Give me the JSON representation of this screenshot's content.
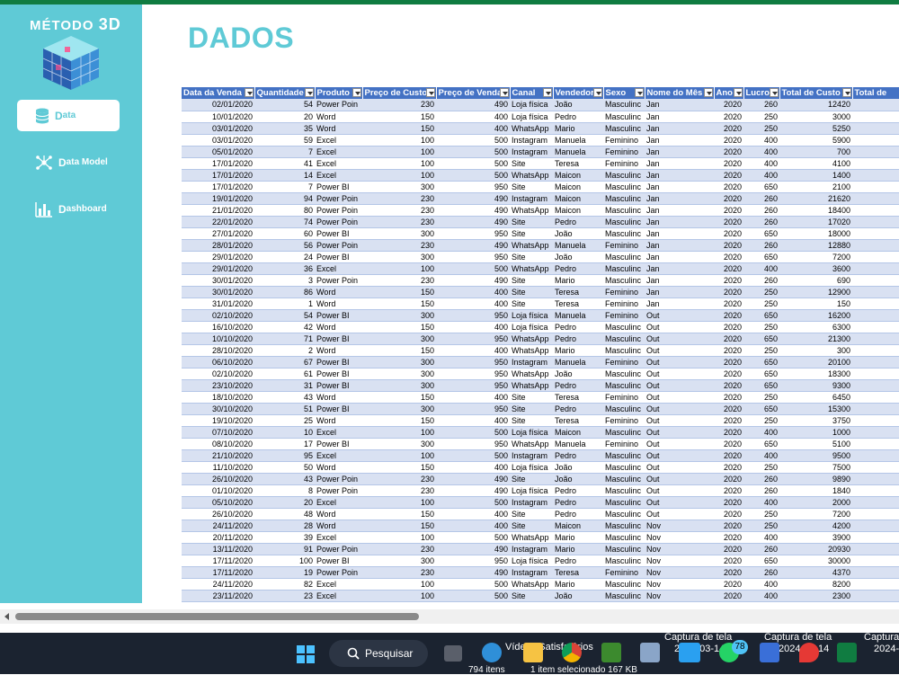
{
  "app": {
    "logo_text_a": "MÉTODO",
    "logo_text_b": "3D",
    "page_title": "DADOS",
    "accent_color": "#5fcad6"
  },
  "sidebar": {
    "items": [
      {
        "first": "D",
        "rest": "ata",
        "icon": "database-icon",
        "active": true
      },
      {
        "first": "D",
        "rest": "ata Model",
        "icon": "network-icon",
        "active": false
      },
      {
        "first": "D",
        "rest": "ashboard",
        "icon": "bar-chart-icon",
        "active": false
      }
    ]
  },
  "table": {
    "headers": [
      "Data da Venda",
      "Quantidade",
      "Produto",
      "Preço de Custo",
      "Preço de Venda",
      "Canal",
      "Vendedor",
      "Sexo",
      "Nome do Mês",
      "Ano",
      "Lucro",
      "Total de Custo",
      "Total de"
    ],
    "rows": [
      [
        "02/01/2020",
        "54",
        "Power Poin",
        "230",
        "490",
        "Loja física",
        "João",
        "Masculinc",
        "Jan",
        "2020",
        "260",
        "12420"
      ],
      [
        "10/01/2020",
        "20",
        "Word",
        "150",
        "400",
        "Loja física",
        "Pedro",
        "Masculinc",
        "Jan",
        "2020",
        "250",
        "3000"
      ],
      [
        "03/01/2020",
        "35",
        "Word",
        "150",
        "400",
        "WhatsApp",
        "Mario",
        "Masculinc",
        "Jan",
        "2020",
        "250",
        "5250"
      ],
      [
        "03/01/2020",
        "59",
        "Excel",
        "100",
        "500",
        "Instagram",
        "Manuela",
        "Feminino",
        "Jan",
        "2020",
        "400",
        "5900"
      ],
      [
        "05/01/2020",
        "7",
        "Excel",
        "100",
        "500",
        "Instagram",
        "Manuela",
        "Feminino",
        "Jan",
        "2020",
        "400",
        "700"
      ],
      [
        "17/01/2020",
        "41",
        "Excel",
        "100",
        "500",
        "Site",
        "Teresa",
        "Feminino",
        "Jan",
        "2020",
        "400",
        "4100"
      ],
      [
        "17/01/2020",
        "14",
        "Excel",
        "100",
        "500",
        "WhatsApp",
        "Maicon",
        "Masculinc",
        "Jan",
        "2020",
        "400",
        "1400"
      ],
      [
        "17/01/2020",
        "7",
        "Power BI",
        "300",
        "950",
        "Site",
        "Maicon",
        "Masculinc",
        "Jan",
        "2020",
        "650",
        "2100"
      ],
      [
        "19/01/2020",
        "94",
        "Power Poin",
        "230",
        "490",
        "Instagram",
        "Maicon",
        "Masculinc",
        "Jan",
        "2020",
        "260",
        "21620"
      ],
      [
        "21/01/2020",
        "80",
        "Power Poin",
        "230",
        "490",
        "WhatsApp",
        "Maicon",
        "Masculinc",
        "Jan",
        "2020",
        "260",
        "18400"
      ],
      [
        "22/01/2020",
        "74",
        "Power Poin",
        "230",
        "490",
        "Site",
        "Pedro",
        "Masculinc",
        "Jan",
        "2020",
        "260",
        "17020"
      ],
      [
        "27/01/2020",
        "60",
        "Power BI",
        "300",
        "950",
        "Site",
        "João",
        "Masculinc",
        "Jan",
        "2020",
        "650",
        "18000"
      ],
      [
        "28/01/2020",
        "56",
        "Power Poin",
        "230",
        "490",
        "WhatsApp",
        "Manuela",
        "Feminino",
        "Jan",
        "2020",
        "260",
        "12880"
      ],
      [
        "29/01/2020",
        "24",
        "Power BI",
        "300",
        "950",
        "Site",
        "João",
        "Masculinc",
        "Jan",
        "2020",
        "650",
        "7200"
      ],
      [
        "29/01/2020",
        "36",
        "Excel",
        "100",
        "500",
        "WhatsApp",
        "Pedro",
        "Masculinc",
        "Jan",
        "2020",
        "400",
        "3600"
      ],
      [
        "30/01/2020",
        "3",
        "Power Poin",
        "230",
        "490",
        "Site",
        "Mario",
        "Masculinc",
        "Jan",
        "2020",
        "260",
        "690"
      ],
      [
        "30/01/2020",
        "86",
        "Word",
        "150",
        "400",
        "Site",
        "Teresa",
        "Feminino",
        "Jan",
        "2020",
        "250",
        "12900"
      ],
      [
        "31/01/2020",
        "1",
        "Word",
        "150",
        "400",
        "Site",
        "Teresa",
        "Feminino",
        "Jan",
        "2020",
        "250",
        "150"
      ],
      [
        "02/10/2020",
        "54",
        "Power BI",
        "300",
        "950",
        "Loja física",
        "Manuela",
        "Feminino",
        "Out",
        "2020",
        "650",
        "16200"
      ],
      [
        "16/10/2020",
        "42",
        "Word",
        "150",
        "400",
        "Loja física",
        "Pedro",
        "Masculinc",
        "Out",
        "2020",
        "250",
        "6300"
      ],
      [
        "10/10/2020",
        "71",
        "Power BI",
        "300",
        "950",
        "WhatsApp",
        "Pedro",
        "Masculinc",
        "Out",
        "2020",
        "650",
        "21300"
      ],
      [
        "28/10/2020",
        "2",
        "Word",
        "150",
        "400",
        "WhatsApp",
        "Mario",
        "Masculinc",
        "Out",
        "2020",
        "250",
        "300"
      ],
      [
        "06/10/2020",
        "67",
        "Power BI",
        "300",
        "950",
        "Instagram",
        "Manuela",
        "Feminino",
        "Out",
        "2020",
        "650",
        "20100"
      ],
      [
        "02/10/2020",
        "61",
        "Power BI",
        "300",
        "950",
        "WhatsApp",
        "João",
        "Masculinc",
        "Out",
        "2020",
        "650",
        "18300"
      ],
      [
        "23/10/2020",
        "31",
        "Power BI",
        "300",
        "950",
        "WhatsApp",
        "Pedro",
        "Masculinc",
        "Out",
        "2020",
        "650",
        "9300"
      ],
      [
        "18/10/2020",
        "43",
        "Word",
        "150",
        "400",
        "Site",
        "Teresa",
        "Feminino",
        "Out",
        "2020",
        "250",
        "6450"
      ],
      [
        "30/10/2020",
        "51",
        "Power BI",
        "300",
        "950",
        "Site",
        "Pedro",
        "Masculinc",
        "Out",
        "2020",
        "650",
        "15300"
      ],
      [
        "19/10/2020",
        "25",
        "Word",
        "150",
        "400",
        "Site",
        "Teresa",
        "Feminino",
        "Out",
        "2020",
        "250",
        "3750"
      ],
      [
        "07/10/2020",
        "10",
        "Excel",
        "100",
        "500",
        "Loja física",
        "Maicon",
        "Masculinc",
        "Out",
        "2020",
        "400",
        "1000"
      ],
      [
        "08/10/2020",
        "17",
        "Power BI",
        "300",
        "950",
        "WhatsApp",
        "Manuela",
        "Feminino",
        "Out",
        "2020",
        "650",
        "5100"
      ],
      [
        "21/10/2020",
        "95",
        "Excel",
        "100",
        "500",
        "Instagram",
        "Pedro",
        "Masculinc",
        "Out",
        "2020",
        "400",
        "9500"
      ],
      [
        "11/10/2020",
        "50",
        "Word",
        "150",
        "400",
        "Loja física",
        "João",
        "Masculinc",
        "Out",
        "2020",
        "250",
        "7500"
      ],
      [
        "26/10/2020",
        "43",
        "Power Poin",
        "230",
        "490",
        "Site",
        "João",
        "Masculinc",
        "Out",
        "2020",
        "260",
        "9890"
      ],
      [
        "01/10/2020",
        "8",
        "Power Poin",
        "230",
        "490",
        "Loja física",
        "Pedro",
        "Masculinc",
        "Out",
        "2020",
        "260",
        "1840"
      ],
      [
        "05/10/2020",
        "20",
        "Excel",
        "100",
        "500",
        "Instagram",
        "Pedro",
        "Masculinc",
        "Out",
        "2020",
        "400",
        "2000"
      ],
      [
        "26/10/2020",
        "48",
        "Word",
        "150",
        "400",
        "Site",
        "Pedro",
        "Masculinc",
        "Out",
        "2020",
        "250",
        "7200"
      ],
      [
        "24/11/2020",
        "28",
        "Word",
        "150",
        "400",
        "Site",
        "Maicon",
        "Masculinc",
        "Nov",
        "2020",
        "250",
        "4200"
      ],
      [
        "20/11/2020",
        "39",
        "Excel",
        "100",
        "500",
        "WhatsApp",
        "Mario",
        "Masculinc",
        "Nov",
        "2020",
        "400",
        "3900"
      ],
      [
        "13/11/2020",
        "91",
        "Power Poin",
        "230",
        "490",
        "Instagram",
        "Mario",
        "Masculinc",
        "Nov",
        "2020",
        "260",
        "20930"
      ],
      [
        "17/11/2020",
        "100",
        "Power BI",
        "300",
        "950",
        "Loja física",
        "Pedro",
        "Masculinc",
        "Nov",
        "2020",
        "650",
        "30000"
      ],
      [
        "17/11/2020",
        "19",
        "Power Poin",
        "230",
        "490",
        "Instagram",
        "Teresa",
        "Feminino",
        "Nov",
        "2020",
        "260",
        "4370"
      ],
      [
        "24/11/2020",
        "82",
        "Excel",
        "100",
        "500",
        "WhatsApp",
        "Mario",
        "Masculinc",
        "Nov",
        "2020",
        "400",
        "8200"
      ],
      [
        "23/11/2020",
        "23",
        "Excel",
        "100",
        "500",
        "Site",
        "João",
        "Masculinc",
        "Nov",
        "2020",
        "400",
        "2300"
      ]
    ]
  },
  "taskbar": {
    "search_label": "Pesquisar",
    "video_label": "Vídeos Satisfatórios",
    "status_items": "794 itens",
    "status_selected": "1 item selecionado  167 KB",
    "capture1_title": "Captura de tela",
    "capture1_date": "2024-03-14",
    "capture2_title": "Captura de tela",
    "capture2_date": "2024-03-14",
    "capture3_title": "Captura",
    "capture3_date": "2024-",
    "whatsapp_badge": "78"
  }
}
